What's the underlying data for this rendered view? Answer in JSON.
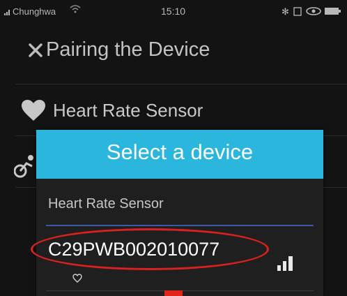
{
  "status_bar": {
    "carrier": "Chunghwa",
    "time": "15:10"
  },
  "header": {
    "close_icon": "close-icon",
    "title": "Pairing the Device"
  },
  "background_list": {
    "heart_rate_label": "Heart Rate Sensor",
    "heart_icon": "heart-icon",
    "bike_icon": "bike-icon"
  },
  "dialog": {
    "title": "Select a device",
    "device_type_label": "Heart Rate Sensor",
    "devices": [
      {
        "id": "C29PWB002010077",
        "signal_icon": "signal-strength-icon",
        "type_icon": "heart-icon"
      }
    ]
  },
  "colors": {
    "dialog_header": "#2ab6dd",
    "background": "#131313",
    "annotation": "#d9211f"
  }
}
